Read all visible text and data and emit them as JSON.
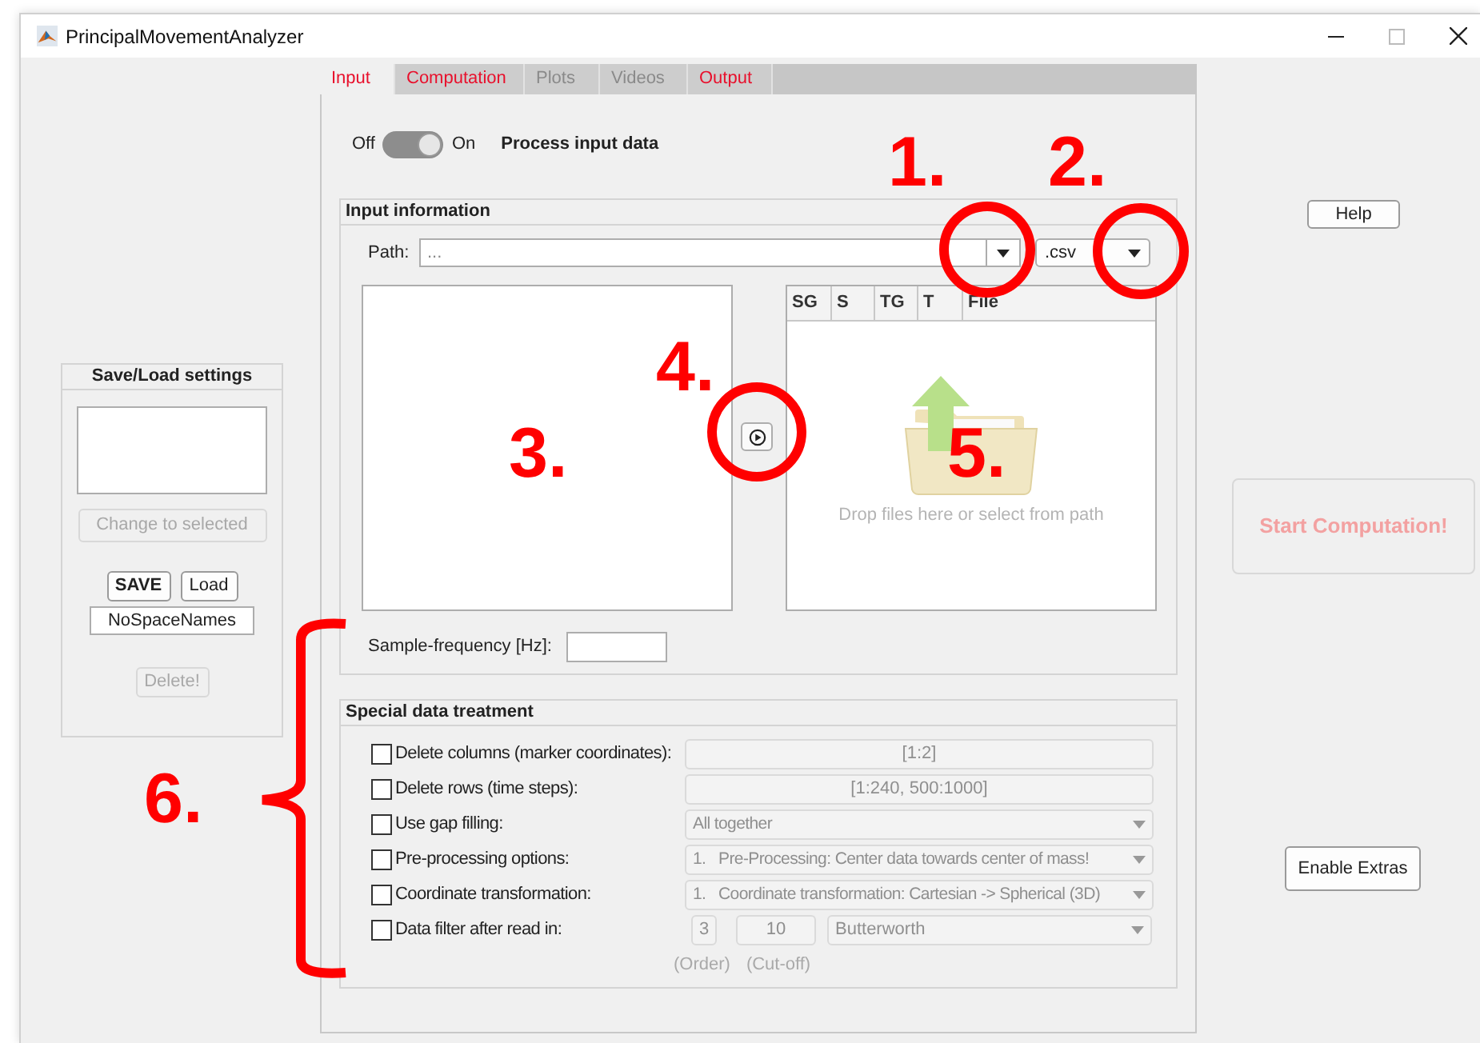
{
  "window": {
    "title": "PrincipalMovementAnalyzer"
  },
  "save_load": {
    "title": "Save/Load settings",
    "change_button": {
      "label": "Change to selected",
      "disabled": true
    },
    "save_button": {
      "label": "SAVE",
      "disabled": false
    },
    "load_button": {
      "label": "Load",
      "disabled": false
    },
    "name_field": {
      "value": "NoSpaceNames"
    },
    "delete_button": {
      "label": "Delete!",
      "disabled": true
    }
  },
  "tabs": [
    {
      "label": "Input",
      "selected": true,
      "disabled": false
    },
    {
      "label": "Computation",
      "selected": false,
      "disabled": false
    },
    {
      "label": "Plots",
      "selected": false,
      "disabled": true
    },
    {
      "label": "Videos",
      "selected": false,
      "disabled": true
    },
    {
      "label": "Output",
      "selected": false,
      "disabled": false
    }
  ],
  "process_switch": {
    "off_label": "Off",
    "on_label": "On",
    "on": true,
    "label": "Process input data"
  },
  "input_information": {
    "title": "Input information",
    "path_label": "Path:",
    "path_value": "...",
    "extension": ".csv",
    "table_columns": [
      "SG",
      "S",
      "TG",
      "T",
      "File"
    ],
    "drop_hint": "Drop files here or select from path",
    "frequency_label": "Sample-frequency [Hz]:"
  },
  "special_treatment": {
    "title": "Special data treatment",
    "options": [
      {
        "kind": "field",
        "label": "Delete columns (marker coordinates):",
        "checked": false,
        "value": "[1:2]"
      },
      {
        "kind": "field",
        "label": "Delete rows (time steps):",
        "checked": false,
        "value": "[1:240, 500:1000]"
      },
      {
        "kind": "dropdown",
        "label": "Use gap filling:",
        "checked": false,
        "value": "All together"
      },
      {
        "kind": "dropdown",
        "label": "Pre-processing options:",
        "checked": false,
        "value": "1.   Pre-Processing: Center data towards center of mass!"
      },
      {
        "kind": "dropdown",
        "label": "Coordinate transformation:",
        "checked": false,
        "value": "1.   Coordinate transformation: Cartesian -> Spherical (3D)"
      },
      {
        "kind": "filter",
        "label": "Data filter after read in:",
        "checked": false,
        "order": "3",
        "cutoff": "10",
        "method": "Butterworth",
        "order_caption": "(Order)",
        "cutoff_caption": "(Cut-off)"
      }
    ]
  },
  "help_button": {
    "label": "Help"
  },
  "start_button": {
    "label": "Start Computation!",
    "disabled": true
  },
  "extras_button": {
    "label": "Enable Extras"
  },
  "annotations": [
    "1.",
    "2.",
    "3.",
    "4.",
    "5.",
    "6."
  ]
}
